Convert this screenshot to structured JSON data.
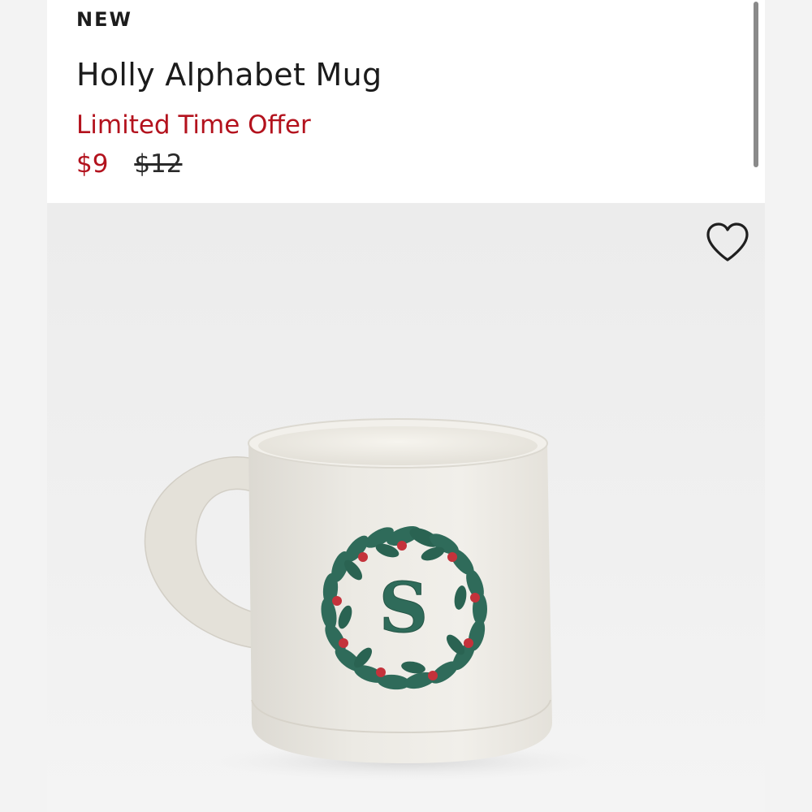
{
  "product": {
    "badge": "NEW",
    "title": "Holly Alphabet Mug",
    "offer_label": "Limited Time Offer",
    "sale_price": "$9",
    "original_price": "$12",
    "accent_color": "#b3121d"
  },
  "image": {
    "favorite_icon": "heart-outline-icon",
    "monogram_letter": "S"
  }
}
